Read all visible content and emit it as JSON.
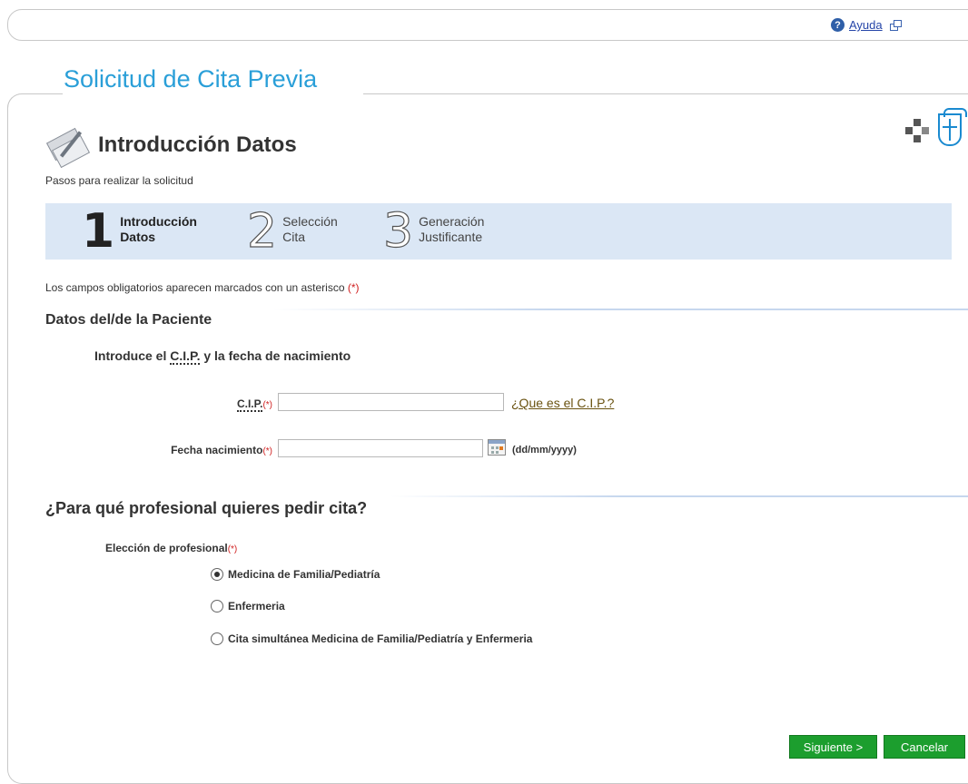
{
  "topbar": {
    "help_label": "Ayuda"
  },
  "app": {
    "title": "Solicitud de Cita Previa"
  },
  "header": {
    "title": "Introducción Datos",
    "steps_caption": "Pasos para realizar la solicitud"
  },
  "steps": [
    {
      "number": "1",
      "line1": "Introducción",
      "line2": "Datos",
      "state": "active"
    },
    {
      "number": "2",
      "line1": "Selección",
      "line2": "Cita",
      "state": "inactive"
    },
    {
      "number": "3",
      "line1": "Generación",
      "line2": "Justificante",
      "state": "inactive"
    }
  ],
  "mandatory_note": {
    "text": "Los campos obligatorios aparecen marcados con un asterisco",
    "marker": "(*)"
  },
  "patient": {
    "heading": "Datos del/de la Paciente",
    "intro_before": "Introduce el",
    "intro_abbr": "C.I.P.",
    "intro_after": "y la fecha de nacimiento",
    "cip_label": "C.I.P.",
    "cip_required": "(*)",
    "cip_value": "",
    "cip_help_link": "¿Que es el C.I.P.?",
    "birth_label": "Fecha nacimiento",
    "birth_required": "(*)",
    "birth_value": "",
    "birth_format": "(dd/mm/yyyy)"
  },
  "professional": {
    "heading": "¿Para qué profesional quieres pedir cita?",
    "label": "Elección de profesional",
    "required": "(*)",
    "options": [
      {
        "label": "Medicina de Familia/Pediatría",
        "selected": true
      },
      {
        "label": "Enfermeria",
        "selected": false
      },
      {
        "label": "Cita simultánea Medicina de Familia/Pediatría y Enfermeria",
        "selected": false
      }
    ]
  },
  "actions": {
    "next": "Siguiente >",
    "cancel": "Cancelar"
  },
  "colors": {
    "title": "#2a9fd8",
    "steps_bg": "#dbe7f5",
    "button": "#1c9e2e",
    "required": "#d02020"
  }
}
